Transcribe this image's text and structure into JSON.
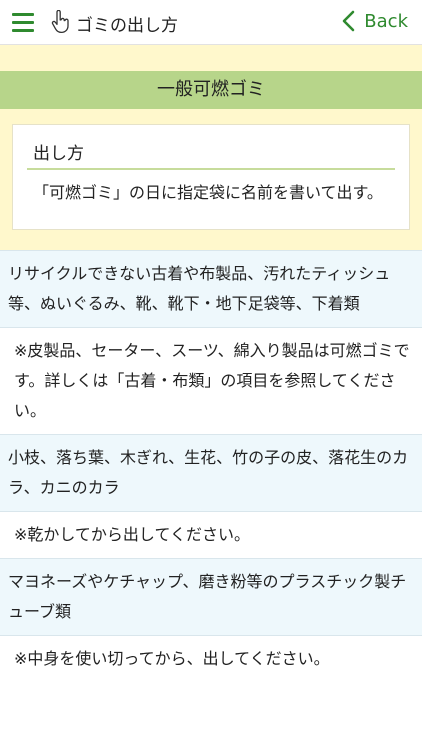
{
  "header": {
    "title": "ゴミの出し方",
    "back_label": "Back",
    "accent": "#2f8a2f"
  },
  "section": {
    "title": "一般可燃ゴミ"
  },
  "card": {
    "heading": "出し方",
    "text": "「可燃ゴミ」の日に指定袋に名前を書いて出す。"
  },
  "rows": [
    {
      "type": "item",
      "text": "リサイクルできない古着や布製品、汚れたティッシュ等、ぬいぐるみ、靴、靴下・地下足袋等、下着類"
    },
    {
      "type": "note",
      "text": "※皮製品、セーター、スーツ、綿入り製品は可燃ゴミです。詳しくは「古着・布類」の項目を参照してください。"
    },
    {
      "type": "item",
      "text": "小枝、落ち葉、木ぎれ、生花、竹の子の皮、落花生のカラ、カニのカラ"
    },
    {
      "type": "note",
      "text": "※乾かしてから出してください。"
    },
    {
      "type": "item",
      "text": "マヨネーズやケチャップ、磨き粉等のプラスチック製チューブ類"
    },
    {
      "type": "note",
      "text": "※中身を使い切ってから、出してください。"
    }
  ]
}
